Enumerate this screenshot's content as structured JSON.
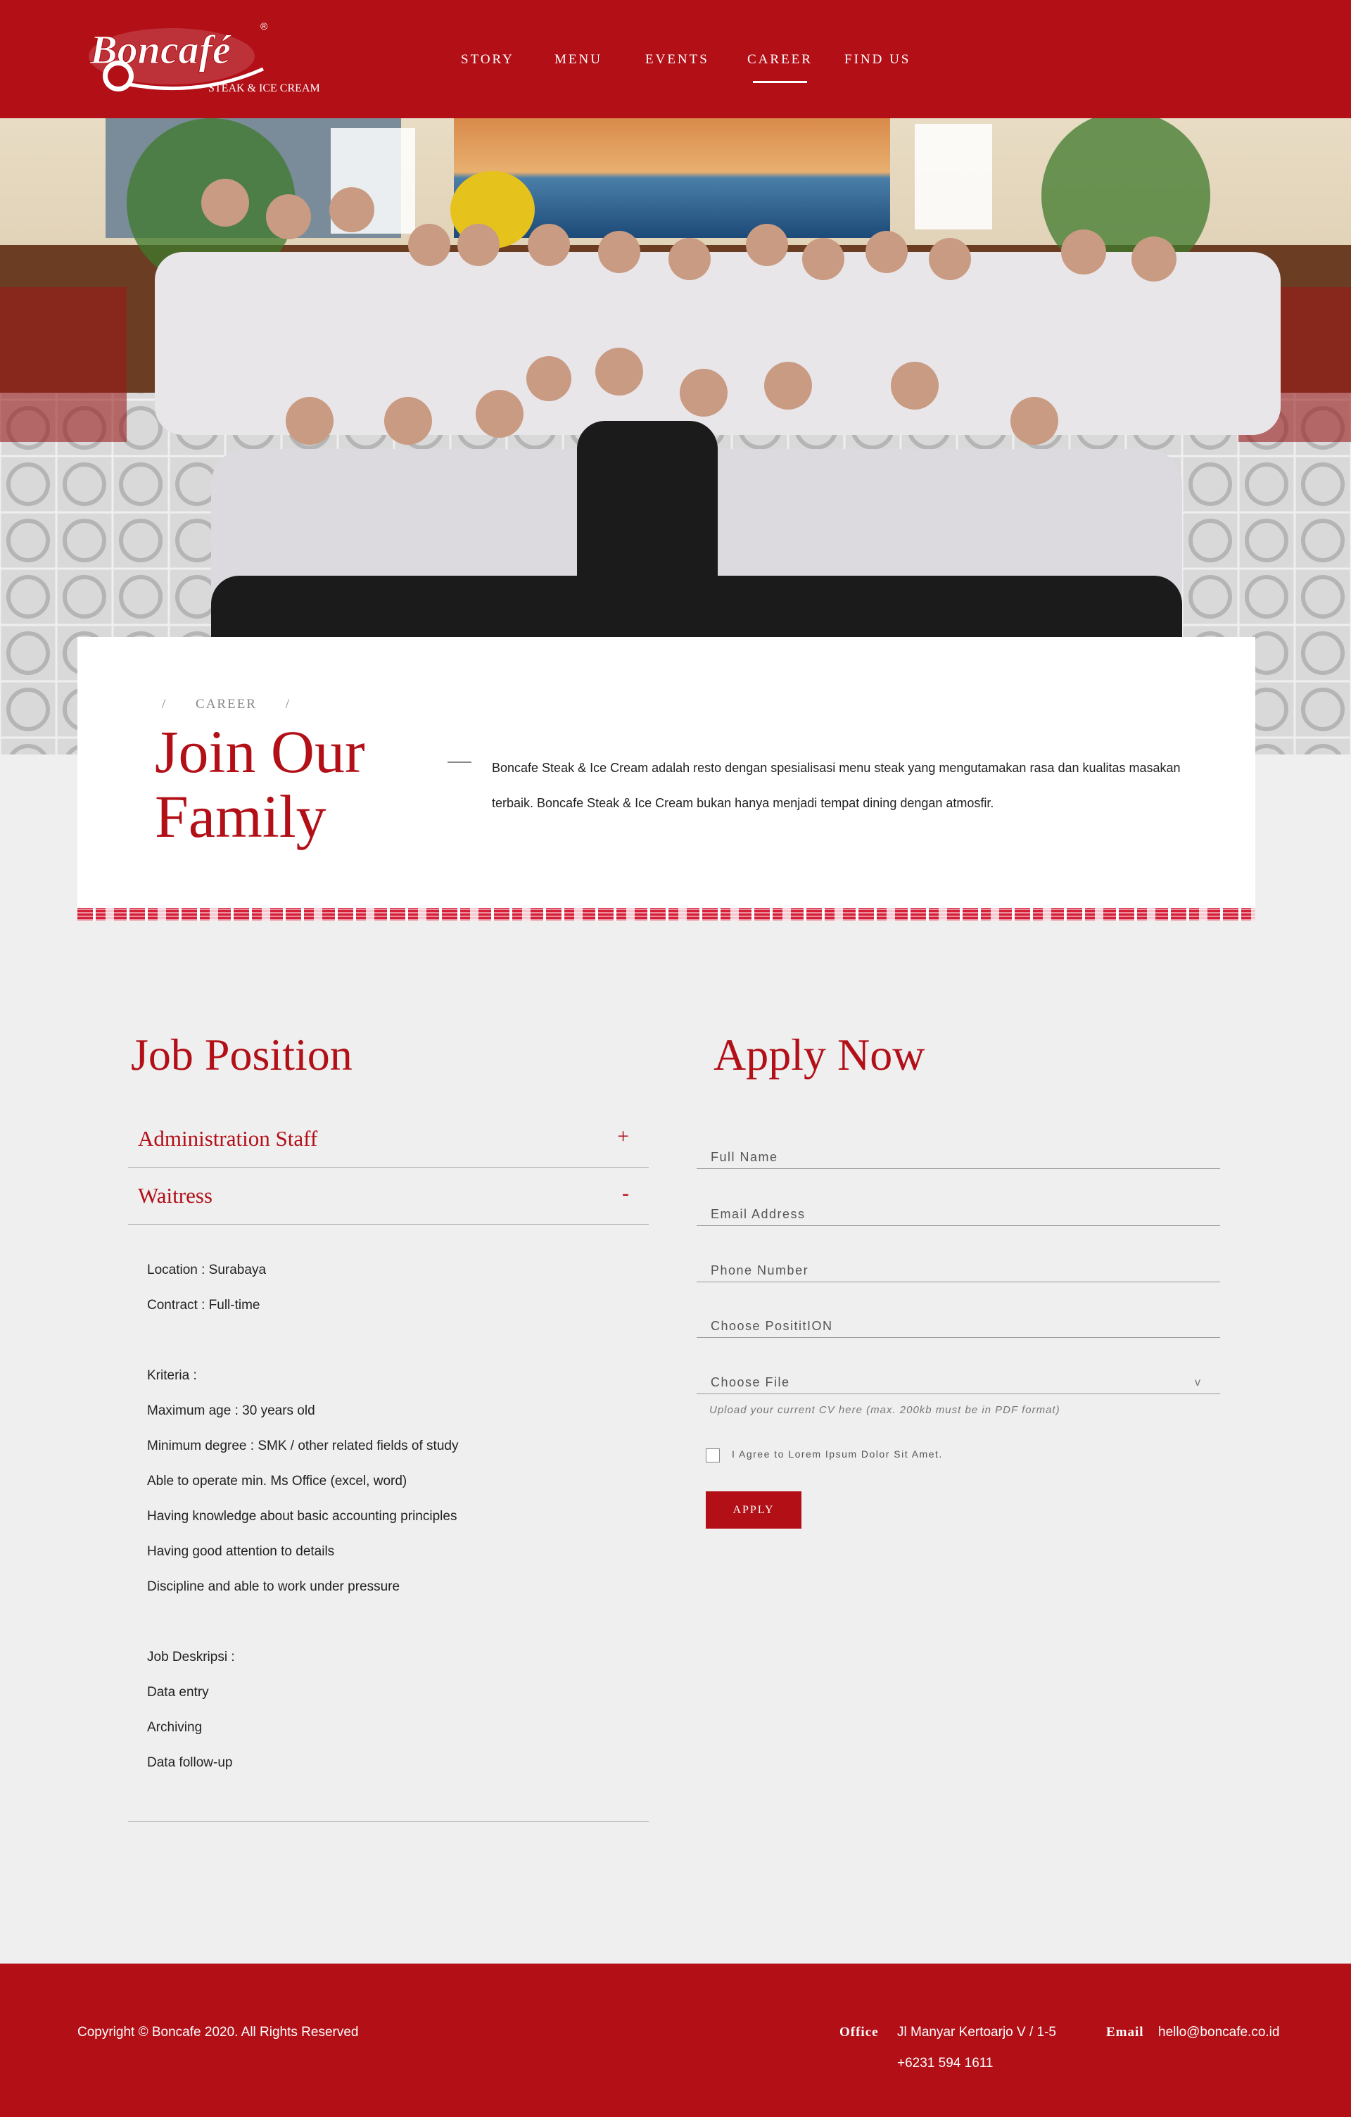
{
  "brand": {
    "name": "Boncafé",
    "tagline": "STEAK & ICE CREAM",
    "registered": "®"
  },
  "nav": {
    "items": [
      "STORY",
      "MENU",
      "EVENTS",
      "CAREER",
      "FIND US"
    ],
    "active": "CAREER"
  },
  "breadcrumb": {
    "sep1": "/",
    "current": "CAREER",
    "sep2": "/"
  },
  "intro": {
    "title_line1": "Join Our",
    "title_line2": "Family",
    "text": "Boncafe Steak & Ice Cream adalah resto dengan spesialisasi menu steak yang mengutamakan rasa dan kualitas masakan terbaik. Boncafe Steak & Ice Cream bukan hanya menjadi tempat dining dengan atmosfir."
  },
  "jobs": {
    "title": "Job Position",
    "items": [
      {
        "label": "Administration Staff",
        "sign": "+"
      },
      {
        "label": "Waitress",
        "sign": "-"
      }
    ],
    "details": [
      "Location : Surabaya",
      "Contract : Full-time",
      "Kriteria :",
      "Maximum age : 30 years old",
      "Minimum degree : SMK / other related fields of study",
      "Able to operate min. Ms Office (excel, word)",
      "Having knowledge about basic accounting principles",
      "Having good attention to details",
      "Discipline and able to work under pressure",
      "Job Deskripsi :",
      "Data entry",
      "Archiving",
      "Data follow-up"
    ]
  },
  "apply": {
    "title": "Apply Now",
    "fields": {
      "full_name": "Full Name",
      "email": "Email Address",
      "phone": "Phone Number",
      "position": "Choose PosititION",
      "file": "Choose File"
    },
    "file_chevron": "v",
    "hint": "Upload your current CV here (max. 200kb must be in PDF format)",
    "agree": "I Agree to Lorem Ipsum Dolor Sit Amet.",
    "button": "APPLY"
  },
  "footer": {
    "copyright": "Copyright © Boncafe 2020. All Rights Reserved",
    "office_label": "Office",
    "office_address": "Jl Manyar Kertoarjo V / 1-5",
    "office_phone": "+6231 594 1611",
    "email_label": "Email",
    "email": "hello@boncafe.co.id"
  },
  "colors": {
    "brand_red": "#b20f17",
    "background": "#efefef"
  }
}
